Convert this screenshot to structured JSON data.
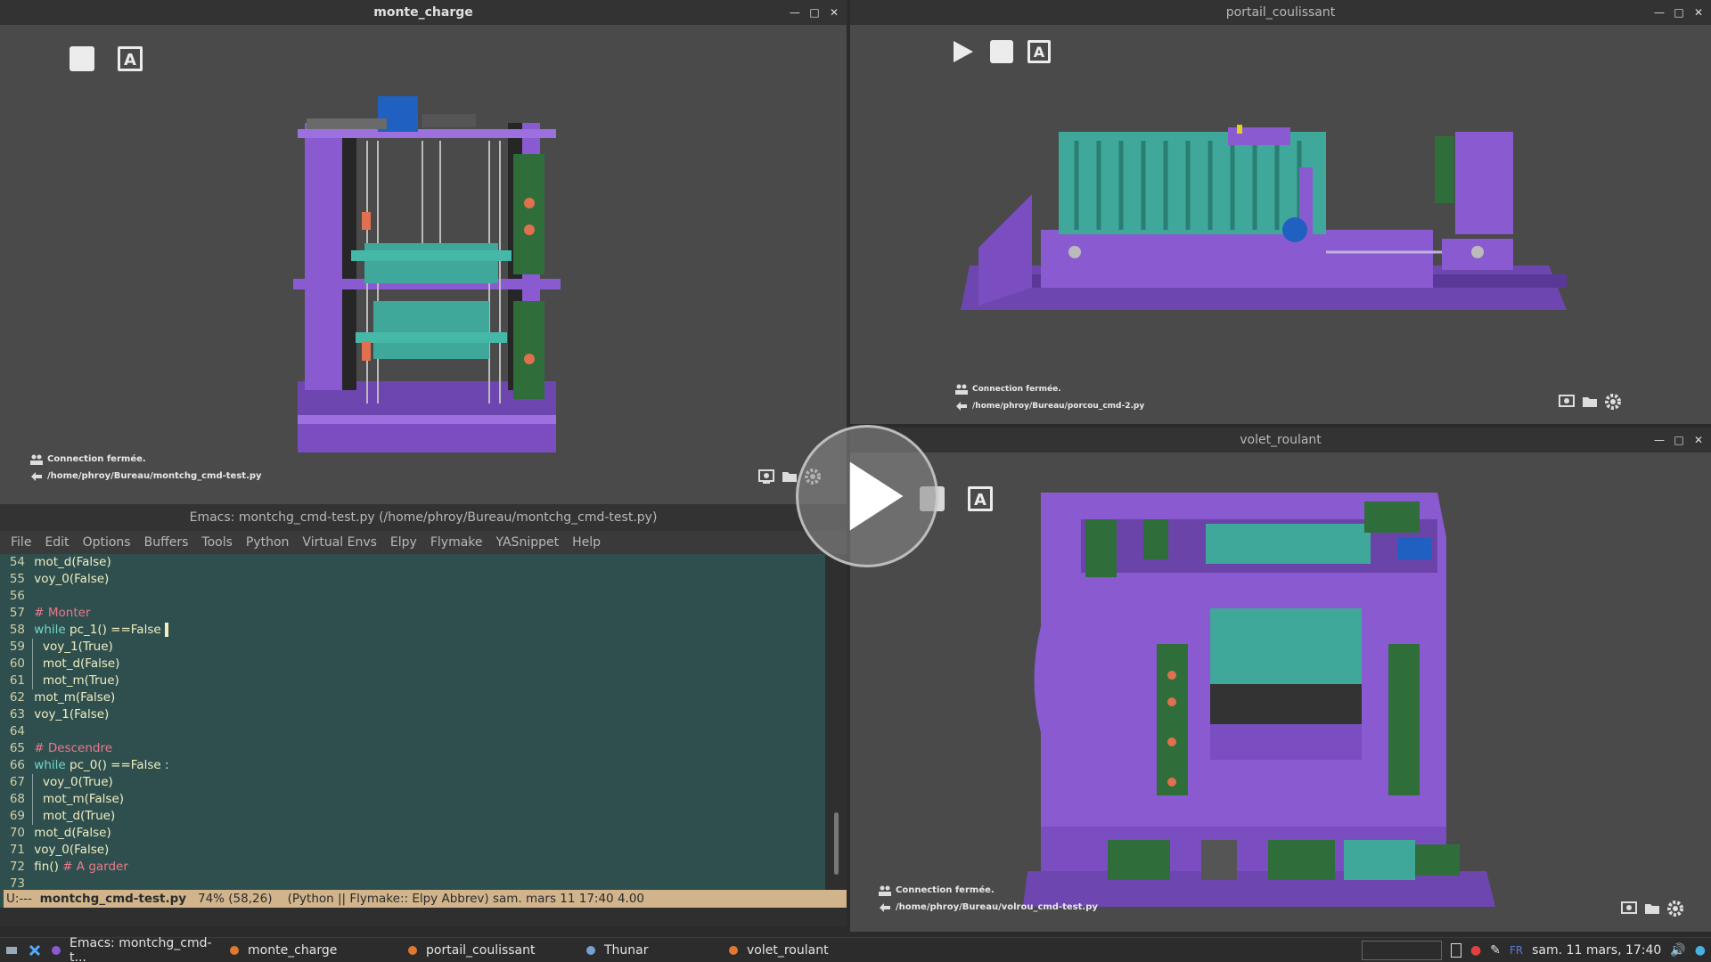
{
  "windows": {
    "monte_charge": {
      "title": "monte_charge",
      "status_connection": "Connection fermée.",
      "status_path": "/home/phroy/Bureau/montchg_cmd-test.py"
    },
    "portail_coulissant": {
      "title": "portail_coulissant",
      "status_connection": "Connection fermée.",
      "status_path": "/home/phroy/Bureau/porcou_cmd-2.py"
    },
    "volet_roulant": {
      "title": "volet_roulant",
      "status_connection": "Connection fermée.",
      "status_path": "/home/phroy/Bureau/volrou_cmd-test.py"
    }
  },
  "emacs": {
    "title": "Emacs: montchg_cmd-test.py (/home/phroy/Bureau/montchg_cmd-test.py)",
    "menu": [
      "File",
      "Edit",
      "Options",
      "Buffers",
      "Tools",
      "Python",
      "Virtual Envs",
      "Elpy",
      "Flymake",
      "YASnippet",
      "Help"
    ],
    "lines": [
      {
        "n": "54",
        "indent": 0,
        "parts": [
          {
            "t": "mot_d(False)"
          }
        ]
      },
      {
        "n": "55",
        "indent": 0,
        "parts": [
          {
            "t": "voy_0(False)"
          }
        ]
      },
      {
        "n": "56",
        "indent": 0,
        "parts": []
      },
      {
        "n": "57",
        "indent": 0,
        "parts": [
          {
            "t": "# Monter",
            "c": "cm"
          }
        ]
      },
      {
        "n": "58",
        "indent": 0,
        "parts": [
          {
            "t": "while",
            "c": "kw"
          },
          {
            "t": " pc_1() ==False "
          }
        ],
        "cursor": true
      },
      {
        "n": "59",
        "indent": 1,
        "parts": [
          {
            "t": "voy_1(True)"
          }
        ]
      },
      {
        "n": "60",
        "indent": 1,
        "parts": [
          {
            "t": "mot_d(False)"
          }
        ]
      },
      {
        "n": "61",
        "indent": 1,
        "parts": [
          {
            "t": "mot_m(True)"
          }
        ]
      },
      {
        "n": "62",
        "indent": 0,
        "parts": [
          {
            "t": "mot_m(False)"
          }
        ]
      },
      {
        "n": "63",
        "indent": 0,
        "parts": [
          {
            "t": "voy_1(False)"
          }
        ]
      },
      {
        "n": "64",
        "indent": 0,
        "parts": []
      },
      {
        "n": "65",
        "indent": 0,
        "parts": [
          {
            "t": "# Descendre",
            "c": "cm"
          }
        ]
      },
      {
        "n": "66",
        "indent": 0,
        "parts": [
          {
            "t": "while",
            "c": "kw"
          },
          {
            "t": " pc_0() ==False :"
          }
        ]
      },
      {
        "n": "67",
        "indent": 1,
        "parts": [
          {
            "t": "voy_0(True)"
          }
        ]
      },
      {
        "n": "68",
        "indent": 1,
        "parts": [
          {
            "t": "mot_m(False)"
          }
        ]
      },
      {
        "n": "69",
        "indent": 1,
        "parts": [
          {
            "t": "mot_d(True)"
          }
        ]
      },
      {
        "n": "70",
        "indent": 0,
        "parts": [
          {
            "t": "mot_d(False)"
          }
        ]
      },
      {
        "n": "71",
        "indent": 0,
        "parts": [
          {
            "t": "voy_0(False)"
          }
        ]
      },
      {
        "n": "72",
        "indent": 0,
        "parts": [
          {
            "t": "fin() "
          },
          {
            "t": "# A garder",
            "c": "cm"
          }
        ]
      },
      {
        "n": "73",
        "indent": 0,
        "parts": []
      }
    ],
    "modeline_prefix": "U:---  ",
    "modeline_file": "montchg_cmd-test.py",
    "modeline_rest": "   74% (58,26)    (Python || Flymake:: Elpy Abbrev) sam. mars 11 17:40 4.00"
  },
  "taskbar": {
    "tasks": [
      {
        "label": "Emacs: montchg_cmd-t...",
        "icon": "emacs-icon"
      },
      {
        "label": "monte_charge",
        "icon": "blender-icon"
      },
      {
        "label": "portail_coulissant",
        "icon": "blender-icon"
      },
      {
        "label": "Thunar",
        "icon": "file-manager-icon"
      },
      {
        "label": "volet_roulant",
        "icon": "blender-icon"
      }
    ],
    "lang": "FR",
    "clock": "sam. 11 mars, 17:40"
  },
  "colors": {
    "machine_purple": "#8a5ad0",
    "cabin_teal": "#3fa89a",
    "pcb_green": "#2f6e3a",
    "modeline": "#d2b48c",
    "editor_bg": "#2f4f4f"
  }
}
